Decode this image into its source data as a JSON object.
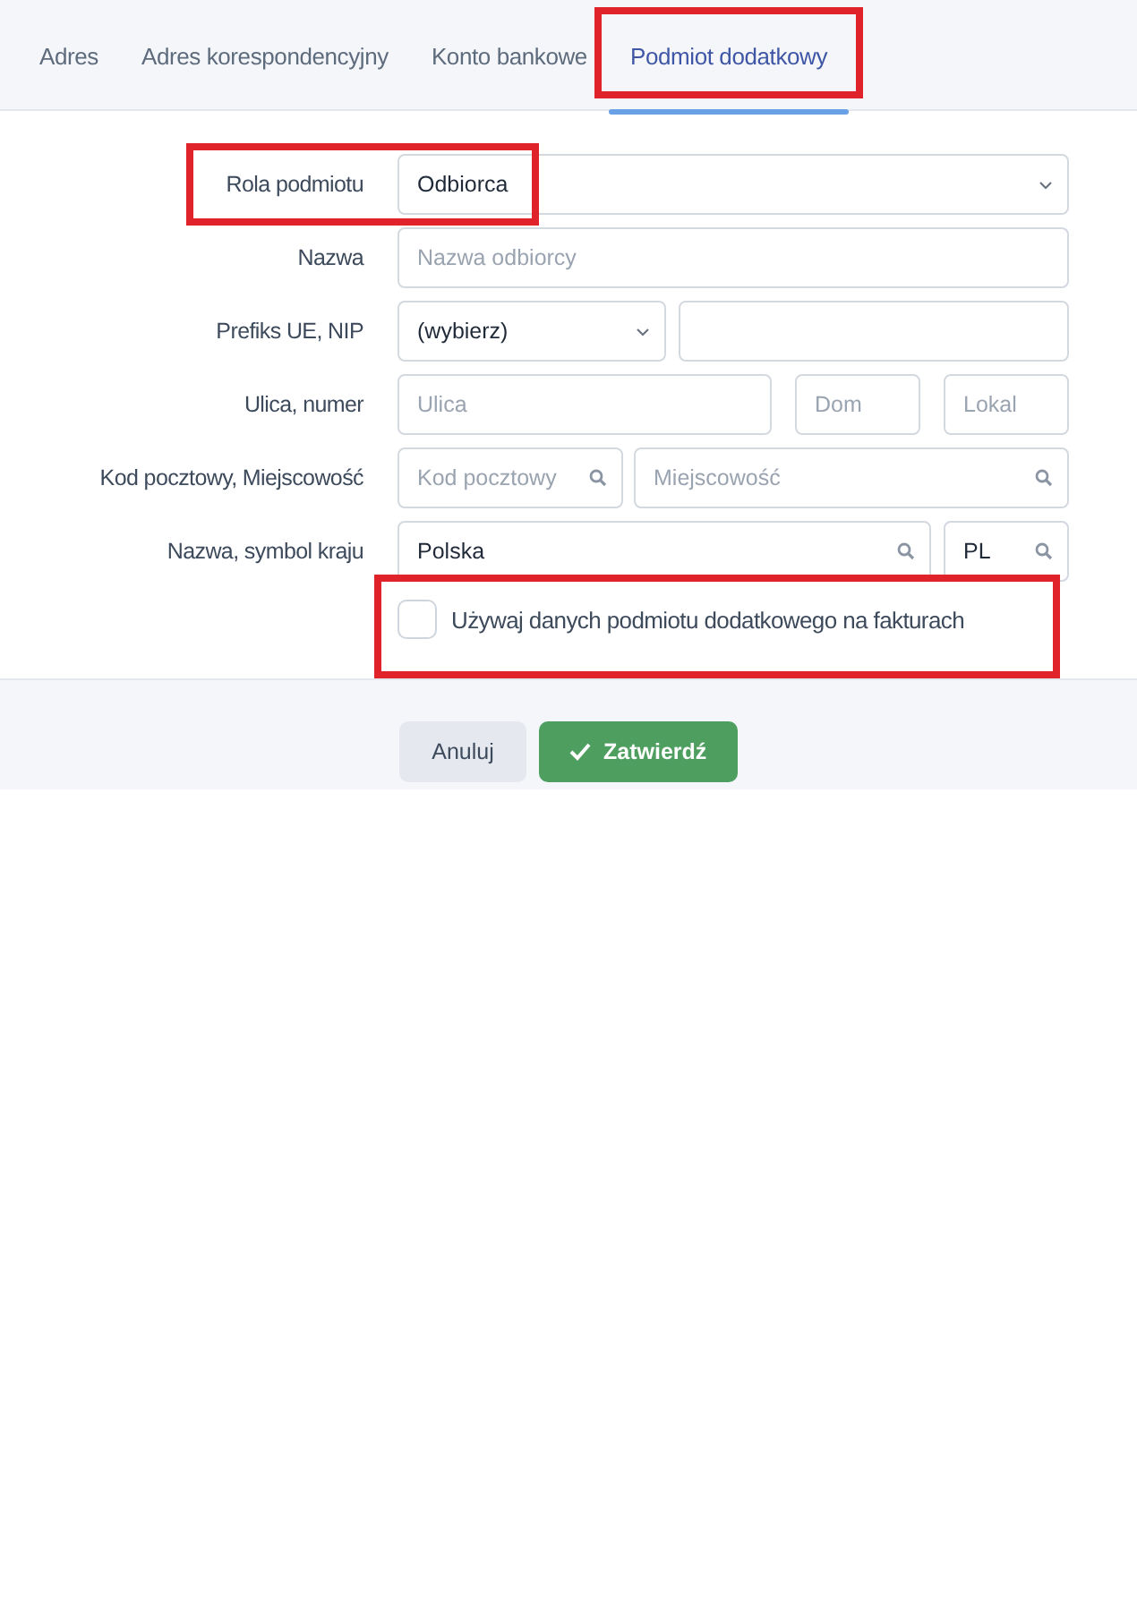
{
  "tabs": [
    {
      "label": "Adres",
      "selected": false,
      "highlighted": false
    },
    {
      "label": "Adres korespondencyjny",
      "selected": false,
      "highlighted": false
    },
    {
      "label": "Konto bankowe",
      "selected": false,
      "highlighted": false
    },
    {
      "label": "Podmiot dodatkowy",
      "selected": true,
      "highlighted": true
    }
  ],
  "form": {
    "rows": [
      {
        "label": "Rola podmiotu",
        "highlighted": true,
        "fields": [
          {
            "kind": "select",
            "value": "Odbiorca"
          }
        ]
      },
      {
        "label": "Nazwa",
        "highlighted": false,
        "fields": [
          {
            "kind": "text",
            "placeholder": "Nazwa odbiorcy"
          }
        ]
      },
      {
        "label": "Prefiks UE, NIP",
        "highlighted": false,
        "fields": [
          {
            "kind": "select",
            "value": "(wybierz)"
          },
          {
            "kind": "text"
          }
        ]
      },
      {
        "label": "Ulica, numer",
        "highlighted": false,
        "fields": [
          {
            "kind": "text",
            "placeholder": "Ulica"
          },
          {
            "kind": "text",
            "placeholder": "Dom"
          },
          {
            "kind": "text",
            "placeholder": "Lokal"
          }
        ]
      },
      {
        "label": "Kod pocztowy, Miejscowość",
        "highlighted": false,
        "fields": [
          {
            "kind": "search",
            "placeholder": "Kod pocztowy"
          },
          {
            "kind": "search",
            "placeholder": "Miejscowość"
          }
        ]
      },
      {
        "label": "Nazwa, symbol kraju",
        "highlighted": false,
        "fields": [
          {
            "kind": "search",
            "value": "Polska"
          },
          {
            "kind": "search",
            "value": "PL"
          }
        ]
      }
    ],
    "checkbox": {
      "label": "Używaj danych podmiotu dodatkowego na fakturach",
      "checked": false,
      "highlighted": true
    }
  },
  "buttons": [
    {
      "kind": "cancel",
      "label": "Anuluj"
    },
    {
      "kind": "confirm",
      "label": "Zatwierdź"
    }
  ]
}
